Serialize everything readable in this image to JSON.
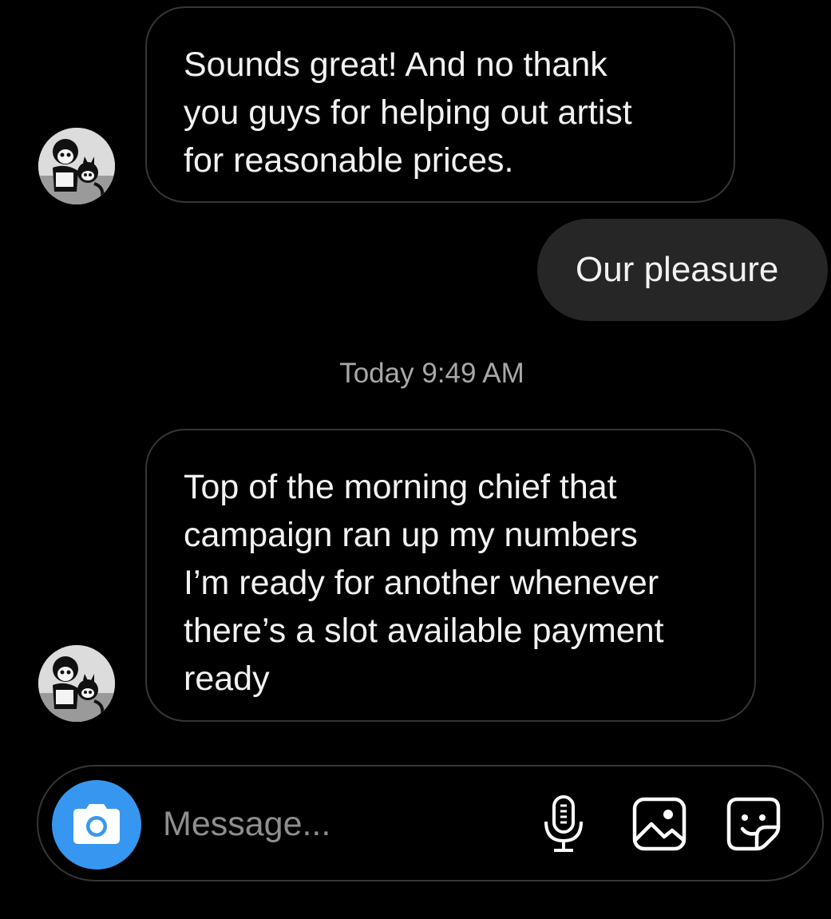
{
  "thread": {
    "messages": [
      {
        "direction": "incoming",
        "text": "Sounds great! And no thank\nyou guys for helping out artist\nfor reasonable prices."
      },
      {
        "direction": "outgoing",
        "text": "Our pleasure"
      },
      {
        "direction": "incoming",
        "text": "Top of the morning chief that\ncampaign ran up my numbers\nI’m ready for another whenever\nthere’s a slot available payment\nready"
      }
    ],
    "timestamp": "Today 9:49 AM"
  },
  "composer": {
    "placeholder": "Message...",
    "camera_icon": "camera-icon",
    "mic_icon": "microphone-icon",
    "gallery_icon": "image-gallery-icon",
    "sticker_icon": "sticker-icon"
  },
  "colors": {
    "background": "#000000",
    "incoming_border": "#363636",
    "outgoing_bubble": "#262626",
    "camera_button": "#3797f0",
    "timestamp_text": "#a8a8a8",
    "placeholder_text": "#8e8e8e"
  }
}
